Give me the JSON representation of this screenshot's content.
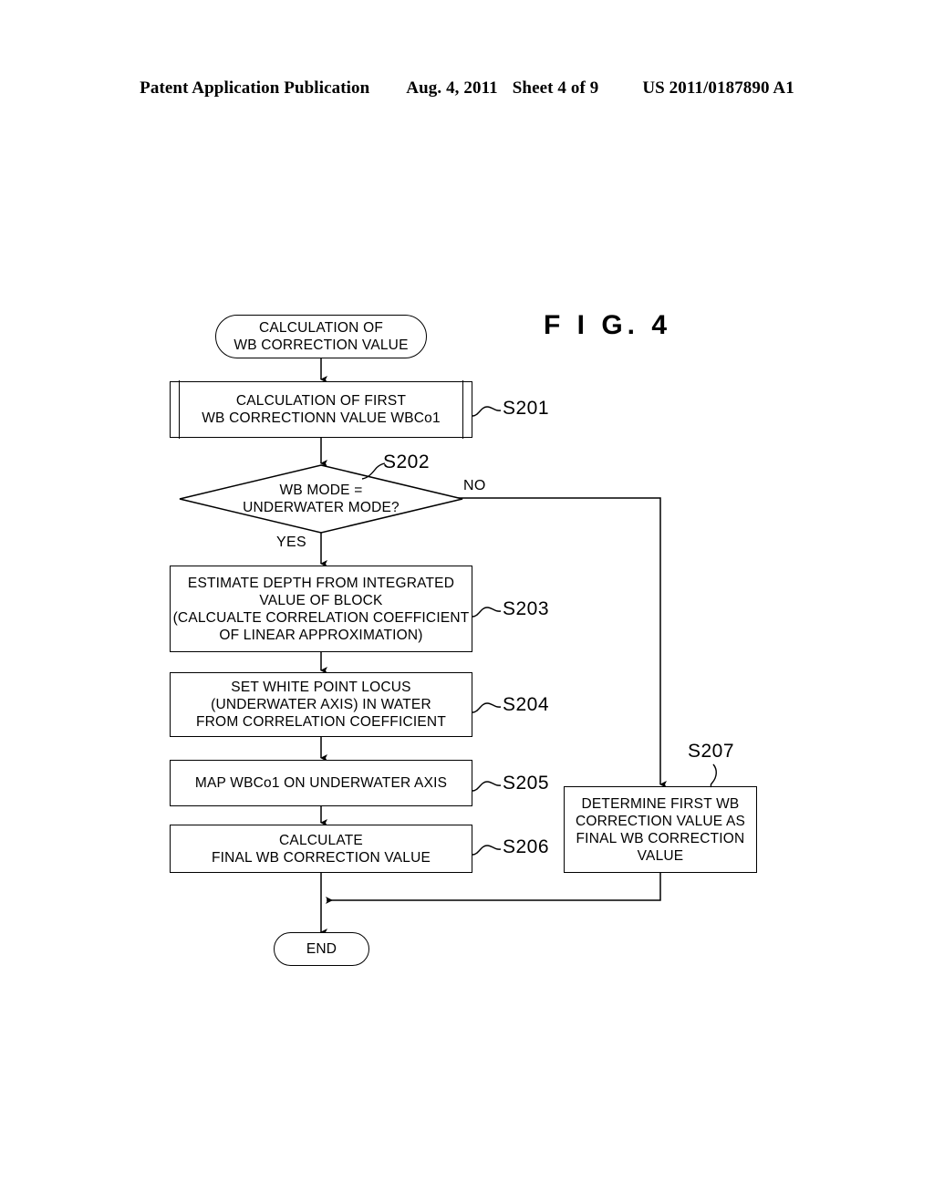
{
  "header": {
    "publication": "Patent Application Publication",
    "date": "Aug. 4, 2011",
    "sheet": "Sheet 4 of 9",
    "number": "US 2011/0187890 A1"
  },
  "figure": {
    "title": "F I G.  4"
  },
  "flowchart": {
    "type": "flowchart",
    "nodes": {
      "start": {
        "shape": "terminal",
        "text": "CALCULATION OF\nWB CORRECTION VALUE"
      },
      "s201": {
        "shape": "predefined-process",
        "text": "CALCULATION OF FIRST\nWB CORRECTIONN VALUE WBCo1",
        "tag": "S201"
      },
      "s202": {
        "shape": "decision",
        "text": "WB MODE =\nUNDERWATER MODE?",
        "tag": "S202",
        "yes_label": "YES",
        "no_label": "NO"
      },
      "s203": {
        "shape": "process",
        "text": "ESTIMATE DEPTH FROM INTEGRATED\nVALUE OF BLOCK\n(CALCUALTE CORRELATION COEFFICIENT\nOF LINEAR APPROXIMATION)",
        "tag": "S203"
      },
      "s204": {
        "shape": "process",
        "text": "SET WHITE POINT LOCUS\n(UNDERWATER AXIS) IN WATER\nFROM CORRELATION COEFFICIENT",
        "tag": "S204"
      },
      "s205": {
        "shape": "process",
        "text": "MAP WBCo1 ON UNDERWATER AXIS",
        "tag": "S205"
      },
      "s206": {
        "shape": "process",
        "text": "CALCULATE\nFINAL WB CORRECTION VALUE",
        "tag": "S206"
      },
      "s207": {
        "shape": "process",
        "text": "DETERMINE FIRST WB\nCORRECTION VALUE AS\nFINAL WB CORRECTION\nVALUE",
        "tag": "S207"
      },
      "end": {
        "shape": "terminal",
        "text": "END"
      }
    },
    "colors": {
      "line": "#000000",
      "fill": "#ffffff",
      "text": "#000000"
    }
  }
}
